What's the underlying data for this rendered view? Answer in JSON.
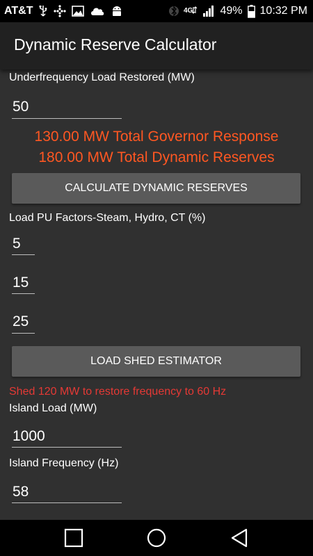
{
  "status_bar": {
    "carrier": "AT&T",
    "battery_percent": "49%",
    "time": "10:32 PM"
  },
  "app": {
    "title": "Dynamic Reserve Calculator"
  },
  "form": {
    "underfrequency_label": "Underfrequency Load Restored (MW)",
    "underfrequency_value": "50",
    "governor_response_result": "130.00 MW Total Governor Response",
    "dynamic_reserves_result": "180.00 MW Total Dynamic Reserves",
    "calculate_button": "CALCULATE DYNAMIC RESERVES",
    "pu_factors_label": "Load PU Factors-Steam, Hydro, CT (%)",
    "pu_steam_value": "5",
    "pu_hydro_value": "15",
    "pu_ct_value": "25",
    "load_shed_button": "LOAD SHED ESTIMATOR",
    "shed_result": "Shed 120 MW to restore frequency to 60 Hz",
    "island_load_label": "Island Load (MW)",
    "island_load_value": "1000",
    "island_frequency_label": "Island Frequency (Hz)",
    "island_frequency_value": "58"
  },
  "icons": {
    "status": [
      "usb-icon",
      "notification-grid-icon",
      "image-icon",
      "cloud-icon",
      "android-icon",
      "bluetooth-icon",
      "lte-icon",
      "signal-icon",
      "battery-icon"
    ],
    "nav": [
      "recents-square-icon",
      "home-circle-icon",
      "back-triangle-icon"
    ]
  },
  "colors": {
    "result_orange": "#ff5722",
    "warning_red": "#e53935",
    "background": "#303030",
    "app_bar": "#212121",
    "button": "#5a5a5a"
  }
}
